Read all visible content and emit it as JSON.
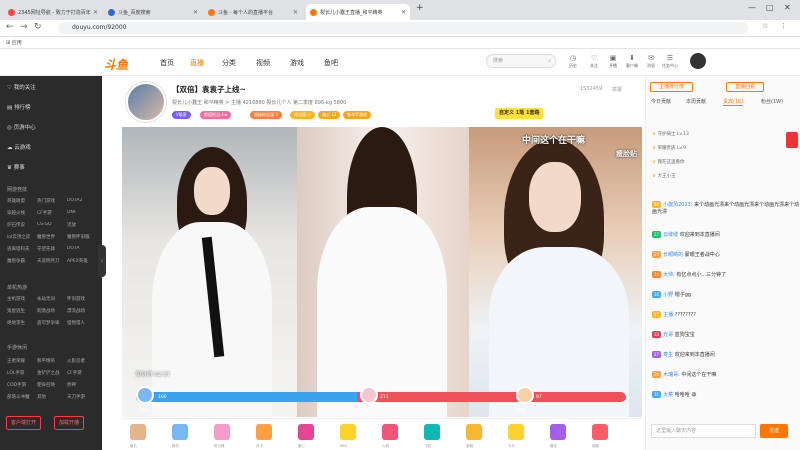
{
  "browser": {
    "tabs": [
      {
        "label": "2345网址导航 - 致力于打造百年",
        "color": "#f44"
      },
      {
        "label": "斗鱼_百度搜索",
        "color": "#3367d6"
      },
      {
        "label": "斗鱼 - 每个人的直播平台",
        "color": "#f70"
      },
      {
        "label": "裂长儿小蠢王直播_和平精英",
        "color": "#f70"
      }
    ],
    "new_tab": "+",
    "url": "douyu.com/92000",
    "bookmark": "应用",
    "win_controls": [
      "—",
      "□",
      "✕"
    ]
  },
  "site": {
    "logo": "斗鱼",
    "nav": [
      "首页",
      "直播",
      "分类",
      "视频",
      "游戏",
      "鱼吧"
    ],
    "nav_active": 1,
    "search_placeholder": "搜索",
    "icons": [
      {
        "icon": "history-icon",
        "label": "历史"
      },
      {
        "icon": "follow-icon",
        "label": "关注"
      },
      {
        "icon": "broadcast-icon",
        "label": "开播"
      },
      {
        "icon": "client-icon",
        "label": "客户端"
      },
      {
        "icon": "message-icon",
        "label": "消息"
      },
      {
        "icon": "task-icon",
        "label": "任务中心"
      }
    ]
  },
  "sidebar": {
    "top": [
      "我的关注",
      "排行榜",
      "页游中心",
      "云游戏",
      "赛事"
    ],
    "sections": [
      {
        "title": "网游竞技",
        "items": [
          "英雄联盟",
          "热门游戏",
          "DOTA2",
          "穿越火线",
          "CF手游",
          "DNF",
          "炉石传说",
          "CS:GO",
          "流放",
          "lol云顶之弈",
          "魔兽世界",
          "魔兽怀旧服",
          "逃离塔科夫",
          "守望先锋",
          "DOTA",
          "魔兽争霸",
          "天涯明月刀",
          "APEX英雄"
        ]
      },
      {
        "title": "单机热游",
        "items": [
          "主机游戏",
          "永劫无间",
          "怀旧游戏",
          "鬼屋逃生",
          "刺激战场",
          "漂流战场",
          "绝地求生",
          "盗可梦争锋",
          "怪物猎人"
        ]
      },
      {
        "title": "手游休闲",
        "items": [
          "王者荣耀",
          "和平精英",
          "火影忍者",
          "LOL手游",
          "金铲铲之战",
          "CF手游",
          "COD手游",
          "使命召唤",
          "原神",
          "部落斗冲魔",
          "其他",
          "天刀手游"
        ]
      }
    ],
    "buttons": [
      "客户端打开",
      "加载开播"
    ]
  },
  "room": {
    "title": "【双倍】袁袁子上线~",
    "sub": "裂长儿小蠢王  和平精英 > 主播  4216880  裂长儿个人  第二季度  896-kg  5800",
    "tags": [
      {
        "t": "V级家",
        "c": "#7b5cff"
      },
      {
        "t": "颜值担当 4★",
        "c": "#f56c9c"
      },
      {
        "t": "超级粉丝团 2",
        "c": "#ff7e3a"
      },
      {
        "t": "成长值 +",
        "c": "#ffb21e"
      },
      {
        "t": "骑士 13",
        "c": "#f5a623"
      },
      {
        "t": "有车手游戏",
        "c": "#f5a623"
      }
    ],
    "follow": "自定义 1笔 1套路",
    "counter": "1552459",
    "report": "举报"
  },
  "video": {
    "overlay_text": "中间这个在干嘛",
    "side_text": "瘦脸贴",
    "timer": "倒计时 02:57",
    "pk": {
      "left_score": "166",
      "left_name": "裂长",
      "mid_score": "211",
      "mid_name": "慕月",
      "right_score": "97",
      "right_name": "桃桃",
      "left_ratio": 0.45
    }
  },
  "gifts": [
    {
      "l": "鱼丸",
      "c": "#e6b38a"
    },
    {
      "l": "鲜花",
      "c": "#7ab8f5"
    },
    {
      "l": "荧光棒",
      "c": "#f59bc7"
    },
    {
      "l": "办卡",
      "c": "#ff9f43"
    },
    {
      "l": "爱心",
      "c": "#e84393"
    },
    {
      "l": "666",
      "c": "#ffd32a"
    },
    {
      "l": "火箭",
      "c": "#ef5777"
    },
    {
      "l": "飞机",
      "c": "#0fb9b1"
    },
    {
      "l": "宝箱",
      "c": "#f7b731"
    },
    {
      "l": "卡片",
      "c": "#fed330"
    },
    {
      "l": "魔法",
      "c": "#a55eea"
    },
    {
      "l": "超跑",
      "c": "#fc5c65"
    }
  ],
  "right": {
    "tabs": [
      "今日贡献",
      "本周贡献",
      "贵宾(1K)",
      "粉丝(1W)"
    ],
    "top_btn": "主播排行榜",
    "top_btn2": "直播回看",
    "ranks": [
      "守护骑士 Lv.13",
      "荣耀贵族 Lv.9",
      "我在这里看你",
      "大王小王"
    ],
    "chats": [
      {
        "lv": "40",
        "c": "#f7b731",
        "u": "小旋风2023:",
        "m": "来个动画光漂来个动画光漂来个动画光漂来个动画光漂"
      },
      {
        "lv": "27",
        "c": "#20bf6b",
        "u": "云缝缝",
        "m": "欢迎来到本直播间"
      },
      {
        "lv": "23",
        "c": "#ff9f43",
        "u": "长眼睛的",
        "m": "蒙眼王者战中心"
      },
      {
        "lv": "24",
        "c": "#fa8231",
        "u": "大帅:",
        "m": "有亿点点小...三分钟了"
      },
      {
        "lv": "16",
        "c": "#45aaf2",
        "u": "小野",
        "m": "帽子gg"
      },
      {
        "lv": "17",
        "c": "#f7b731",
        "u": "主播",
        "m": "????????"
      },
      {
        "lv": "33",
        "c": "#eb3b5a",
        "u": "光哥",
        "m": "蓝狗宝宝"
      },
      {
        "lv": "27",
        "c": "#a55eea",
        "u": "寿生",
        "m": "欢迎来到本直播间"
      },
      {
        "lv": "34",
        "c": "#ff9f43",
        "u": "木瑞哥:",
        "m": "中间这个在干嘛"
      },
      {
        "lv": "31",
        "c": "#45aaf2",
        "u": "大菜",
        "m": "哈哈哈 😆"
      }
    ],
    "input_placeholder": "这里输入聊天内容",
    "send": "发送"
  }
}
